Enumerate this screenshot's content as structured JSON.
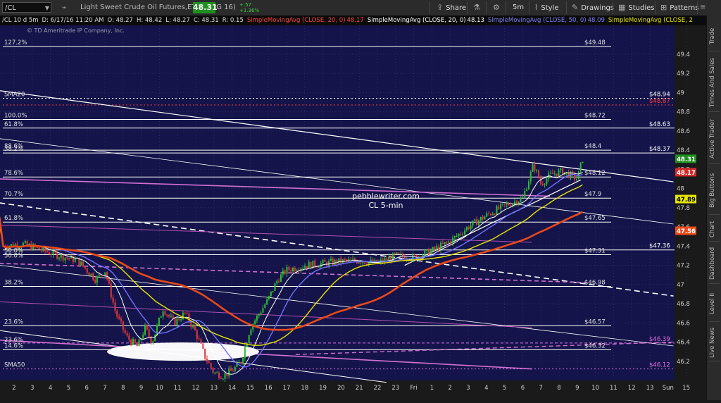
{
  "toolbar": {
    "symbol": "/CL",
    "title": "Light Sweet Crude Oil Futures,ETH (AUG 16)",
    "last": "48.31",
    "change": "+.57",
    "change_pct": "+1.36%",
    "share": "Share",
    "interval": "5m",
    "style": "Style",
    "drawings": "Drawings",
    "studies": "Studies",
    "patterns": "Patterns"
  },
  "header": {
    "symbol": "/CL 10 d 5m",
    "date": "D: 6/17/16 11:20 AM",
    "open": "O: 48.27",
    "high": "H: 48.42",
    "low": "L: 48.27",
    "close": "C: 48.31",
    "range": "R: 0.15",
    "sma1": "SimpleMovingAvg (CLOSE, 20, 0)",
    "sma1_val": "48.17",
    "sma2": "SimpleMovingAvg (CLOSE, 20, 0)",
    "sma2_val": "48.13",
    "sma3": "SimpleMovingAvg (CLOSE, 50, 0)",
    "sma3_val": "48.09",
    "sma4": "SimpleMovingAvg (CLOSE, 2",
    "copyright": "© TD Ameritrade IP Company, Inc."
  },
  "sidebar": [
    "Trade",
    "Times And Sales",
    "Active Trader",
    "Big Buttons",
    "Chart",
    "Dashboard",
    "Level II",
    "Live News"
  ],
  "chart_data": {
    "type": "line",
    "watermark": [
      "pebblewriter.com",
      "CL 5-min"
    ],
    "ylim": [
      46.0,
      49.7
    ],
    "y_ticks": [
      46.2,
      46.4,
      46.6,
      46.8,
      47,
      47.2,
      47.4,
      47.6,
      47.8,
      48,
      48.2,
      48.4,
      48.6,
      48.8,
      49,
      49.2,
      49.4
    ],
    "x_ticks": [
      "2",
      "3",
      "4",
      "5",
      "6",
      "7",
      "8",
      "9",
      "10",
      "11",
      "12",
      "13",
      "14",
      "15",
      "16",
      "17",
      "18",
      "19",
      "20",
      "21",
      "22",
      "23",
      "Fri",
      "1",
      "2",
      "3",
      "4",
      "5",
      "6",
      "7",
      "8",
      "9",
      "10",
      "11",
      "12",
      "13",
      "Sun",
      "15"
    ],
    "fib_levels": [
      {
        "label": "127.2%",
        "value": 49.48,
        "text": "$49.48",
        "color": "#ffffff"
      },
      {
        "label": "100.0%",
        "value": 48.72,
        "text": "$48.72",
        "color": "#ffffff"
      },
      {
        "label": "88.6%",
        "value": 48.4,
        "text": "$48.4",
        "color": "#ffffff"
      },
      {
        "label": "78.6%",
        "value": 48.12,
        "text": "$48.12",
        "color": "#ffffff"
      },
      {
        "label": "70.7%",
        "value": 47.9,
        "text": "$47.9",
        "color": "#ffffff"
      },
      {
        "label": "61.8%",
        "value": 47.65,
        "text": "$47.65",
        "color": "#ffffff"
      },
      {
        "label": "50.0%",
        "value": 47.31,
        "text": "$47.31",
        "color": "#ffffff"
      },
      {
        "label": "38.2%",
        "value": 46.98,
        "text": "$46.98",
        "color": "#ffffff"
      },
      {
        "label": "23.6%",
        "value": 46.57,
        "text": "$46.57",
        "color": "#ffffff"
      },
      {
        "label": "14.6%",
        "value": 46.32,
        "text": "$46.32",
        "color": "#ffffff"
      }
    ],
    "right_levels": [
      {
        "text": "$48.94",
        "value": 48.94,
        "color": "#ffffff",
        "dash": "2,3"
      },
      {
        "text": "$48.87",
        "value": 48.87,
        "color": "#ff3a3a",
        "dash": "2,3"
      },
      {
        "text": "$48.63",
        "value": 48.63,
        "color": "#ffffff",
        "dash": ""
      },
      {
        "text": "$48.37",
        "value": 48.37,
        "color": "#ffffff",
        "dash": ""
      },
      {
        "text": "$47.36",
        "value": 47.36,
        "color": "#ffffff",
        "dash": ""
      },
      {
        "text": "$46.39",
        "value": 46.39,
        "color": "#e070e0",
        "dash": "4,3"
      },
      {
        "text": "$46.12",
        "value": 46.12,
        "color": "#e070e0",
        "dash": "2,3"
      }
    ],
    "left_labels": [
      {
        "text": "SMA20",
        "value": 48.94
      },
      {
        "text": "61.8%",
        "value": 48.63
      },
      {
        "text": "38.2%",
        "value": 48.37
      },
      {
        "text": "50.0%",
        "value": 47.26
      },
      {
        "text": "23.6%",
        "value": 46.38
      },
      {
        "text": "SMA50",
        "value": 46.12
      }
    ],
    "axis_badges": [
      {
        "text": "48.31",
        "value": 48.31,
        "color": "#1f8f1f"
      },
      {
        "text": "48.17",
        "value": 48.17,
        "color": "#d22b2b"
      },
      {
        "text": "47.89",
        "value": 47.89,
        "color": "#e6e600"
      },
      {
        "text": "47.56",
        "value": 47.56,
        "color": "#e84a1a"
      }
    ],
    "colors": {
      "background": "#14144a",
      "up": "#2fbf2f",
      "down": "#e03a3a",
      "sma20": "#ffffff",
      "sma50": "#7070ff",
      "sma_yellow": "#e6e600",
      "sma_red": "#e84a1a",
      "trend": "#ffffff",
      "magenta": "#d070d0"
    }
  }
}
